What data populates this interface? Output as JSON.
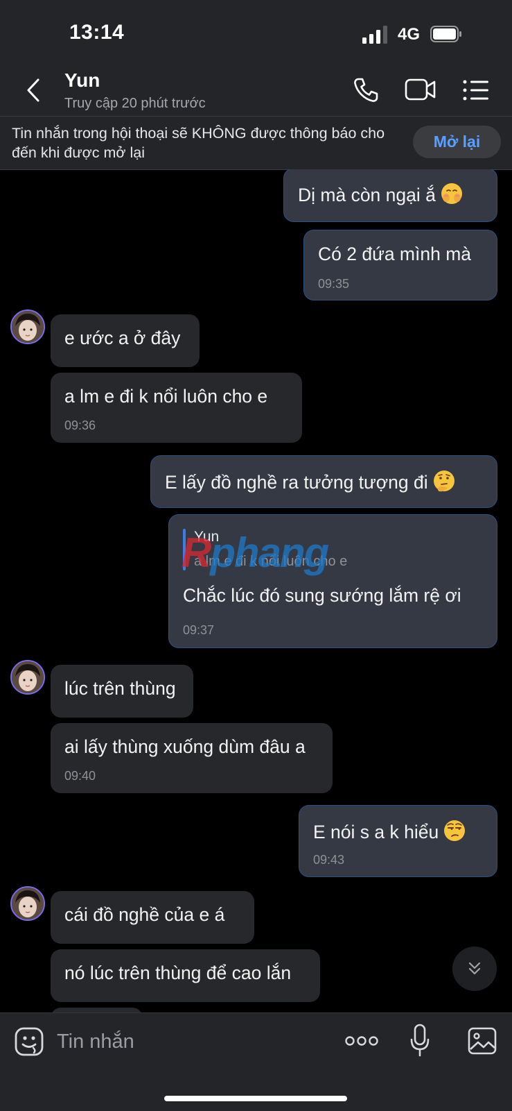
{
  "status_bar": {
    "time": "13:14",
    "network": "4G",
    "signal_level": 3,
    "battery_level": 0.9
  },
  "header": {
    "back_icon": "chevron-left-icon",
    "name": "Yun",
    "status": "Truy cập 20 phút trước",
    "icons": [
      "phone-icon",
      "video-camera-icon",
      "menu-icon"
    ]
  },
  "banner": {
    "text": "Tin nhắn trong hội thoại sẽ KHÔNG được thông báo cho đến khi được mở lại",
    "button": "Mở lại"
  },
  "messages": [
    {
      "dir": "out",
      "text": "Dị mà còn ngại ắ",
      "emoji": "shy-face-emoji"
    },
    {
      "dir": "out",
      "text": "Có 2 đứa mình mà",
      "time": "09:35"
    },
    {
      "dir": "in",
      "text": "e ước a ở đây"
    },
    {
      "dir": "in",
      "text": "a lm e đi k nổi luôn cho e",
      "time": "09:36"
    },
    {
      "dir": "out",
      "text": "E lấy đồ nghề ra tưởng tượng đi",
      "emoji": "thinking-face-emoji"
    },
    {
      "dir": "out",
      "reply_name": "Yun",
      "reply_text": "a lm e đi k nổi luôn cho e",
      "text": "Chắc lúc đó sung sướng lắm rệ ơi",
      "time": "09:37"
    },
    {
      "dir": "in",
      "text": "lúc trên thùng"
    },
    {
      "dir": "in",
      "text": "ai lấy thùng xuống dùm đâu a",
      "time": "09:40"
    },
    {
      "dir": "out",
      "text": "E nói s a k hiểu",
      "emoji": "unamused-face-emoji",
      "time": "09:43"
    },
    {
      "dir": "in",
      "text": "cái đồ nghề của e á"
    },
    {
      "dir": "in",
      "text": "nó lúc trên thùng để cao lắn"
    }
  ],
  "watermark": "Rphang",
  "composer": {
    "placeholder": "Tin nhắn",
    "icons": [
      "sticker-icon",
      "more-icon",
      "microphone-icon",
      "image-icon"
    ]
  },
  "scroll_button_icon": "double-chevron-down-icon",
  "colors": {
    "accent": "#5aa0ff",
    "outgoing_bubble": "#353943",
    "incoming_bubble": "#27282b",
    "avatar_ring": "#7c6cf0"
  }
}
